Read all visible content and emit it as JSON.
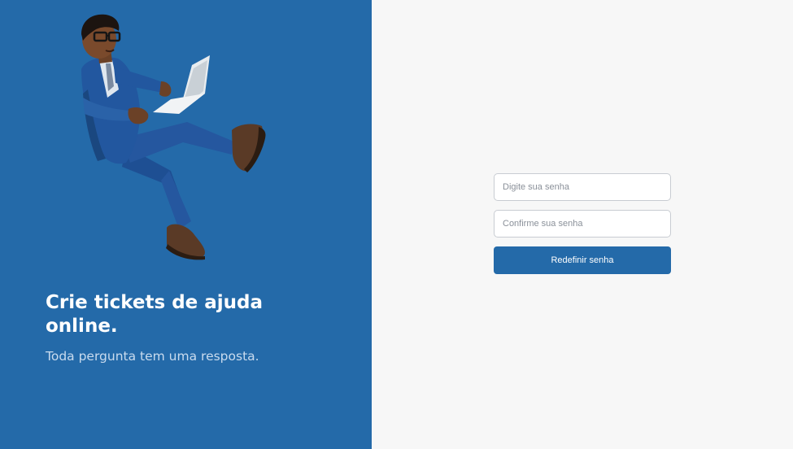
{
  "hero": {
    "title": "Crie tickets de ajuda online.",
    "subtitle": "Toda pergunta tem uma resposta.",
    "illustration": "businessman-with-laptop-illustration"
  },
  "form": {
    "password_placeholder": "Digite sua senha",
    "confirm_placeholder": "Confirme sua senha",
    "submit_label": "Redefinir senha"
  },
  "colors": {
    "brand_blue": "#246aa9",
    "right_background": "#f7f7f7",
    "subtitle_text": "#c9dbee"
  }
}
